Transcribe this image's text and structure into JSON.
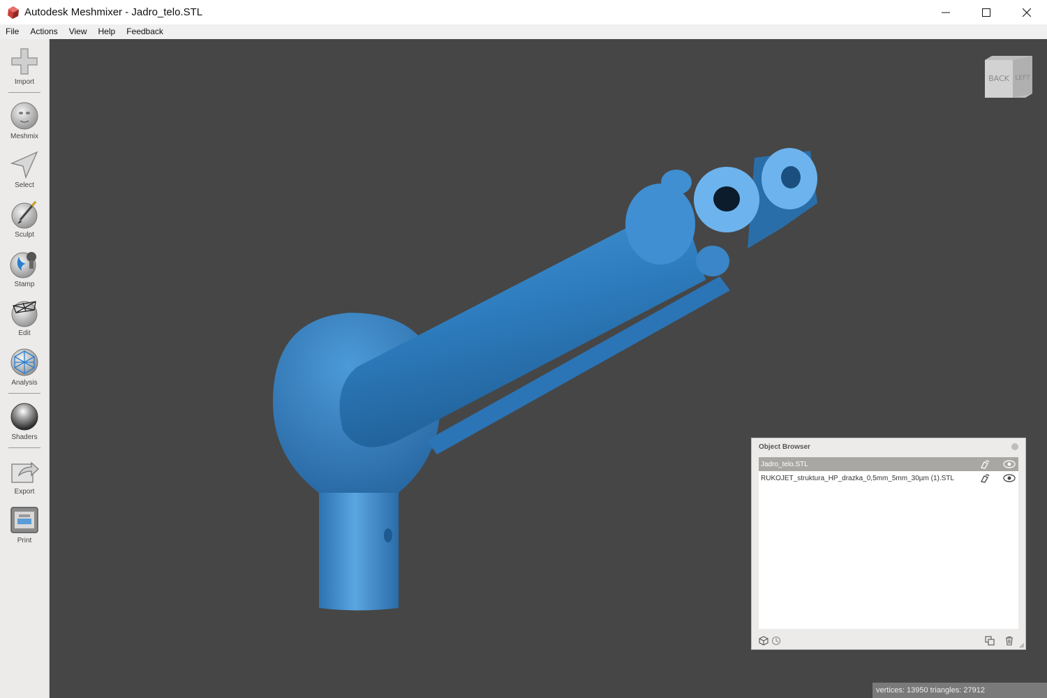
{
  "window": {
    "title": "Autodesk Meshmixer - Jadro_telo.STL"
  },
  "menu": [
    "File",
    "Actions",
    "View",
    "Help",
    "Feedback"
  ],
  "tools": [
    {
      "label": "Import",
      "icon": "plus-icon"
    },
    {
      "label": "Meshmix",
      "icon": "bunny-sphere-icon"
    },
    {
      "label": "Select",
      "icon": "arrow-pointer-icon"
    },
    {
      "label": "Sculpt",
      "icon": "brush-icon"
    },
    {
      "label": "Stamp",
      "icon": "stamp-icon"
    },
    {
      "label": "Edit",
      "icon": "wireframe-sphere-icon"
    },
    {
      "label": "Analysis",
      "icon": "mesh-sphere-icon"
    },
    {
      "label": "Shaders",
      "icon": "shader-sphere-icon"
    },
    {
      "label": "Export",
      "icon": "export-icon"
    },
    {
      "label": "Print",
      "icon": "printer-icon"
    }
  ],
  "viewcube": {
    "faces": [
      "BACK",
      "LEFT"
    ]
  },
  "object_browser": {
    "title": "Object Browser",
    "objects": [
      {
        "name": "Jadro_telo.STL",
        "selected": true
      },
      {
        "name": "RUKOJET_struktura_HP_drazka_0,5mm_5mm_30µm (1).STL",
        "selected": false
      }
    ]
  },
  "status": {
    "text": "vertices: 13950 triangles: 27912"
  },
  "colors": {
    "model": "#3a86c8",
    "viewport_bg": "#464646",
    "toolbar_bg": "#ecebe9",
    "selected_row": "#a9a7a4"
  }
}
